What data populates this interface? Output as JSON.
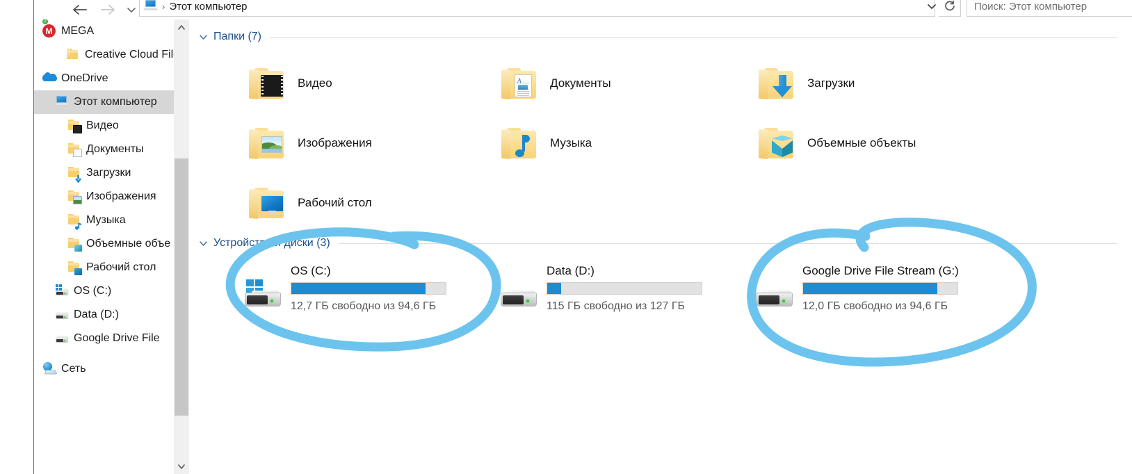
{
  "window": {
    "address": {
      "crumb_root": "Этот компьютер",
      "separator": "›",
      "dropdown_icon": "chevron-down-icon",
      "refresh_icon": "refresh-icon"
    },
    "search": {
      "placeholder": "Поиск: Этот компьютер",
      "value": ""
    },
    "nav_buttons": {
      "back": "back-arrow-icon",
      "forward": "forward-arrow-icon",
      "recent": "recent-locations-chevron-icon",
      "up": "up-arrow-icon"
    }
  },
  "sidebar": {
    "items": [
      {
        "label": "MEGA",
        "icon": "mega-icon",
        "indent": 0,
        "selected": false
      },
      {
        "label": "Creative Cloud File",
        "icon": "folder-icon",
        "indent": 1,
        "selected": false
      },
      {
        "label": "OneDrive",
        "icon": "onedrive-cloud-icon",
        "indent": 0,
        "selected": false
      },
      {
        "label": "Этот компьютер",
        "icon": "this-pc-icon",
        "indent": 1,
        "selected": true
      },
      {
        "label": "Видео",
        "icon": "videos-folder-icon",
        "indent": 2,
        "selected": false
      },
      {
        "label": "Документы",
        "icon": "documents-folder-icon",
        "indent": 2,
        "selected": false
      },
      {
        "label": "Загрузки",
        "icon": "downloads-folder-icon",
        "indent": 2,
        "selected": false
      },
      {
        "label": "Изображения",
        "icon": "pictures-folder-icon",
        "indent": 2,
        "selected": false
      },
      {
        "label": "Музыка",
        "icon": "music-folder-icon",
        "indent": 2,
        "selected": false
      },
      {
        "label": "Объемные объе",
        "icon": "3d-objects-folder-icon",
        "indent": 2,
        "selected": false
      },
      {
        "label": "Рабочий стол",
        "icon": "desktop-folder-icon",
        "indent": 2,
        "selected": false
      },
      {
        "label": "OS (C:)",
        "icon": "windows-drive-icon",
        "indent": 1,
        "selected": false
      },
      {
        "label": "Data (D:)",
        "icon": "drive-icon",
        "indent": 1,
        "selected": false
      },
      {
        "label": "Google Drive File",
        "icon": "drive-icon",
        "indent": 1,
        "selected": false
      },
      {
        "label": "Сеть",
        "icon": "network-icon",
        "indent": 0,
        "selected": false
      }
    ],
    "scrollbar": {
      "up_arrow": "chevron-up-icon",
      "down_arrow": "chevron-down-icon"
    }
  },
  "content": {
    "groups": [
      {
        "title": "Папки (7)",
        "chevron": "chevron-down-icon"
      },
      {
        "title": "Устройства и диски (3)",
        "chevron": "chevron-down-icon"
      }
    ],
    "folders": [
      {
        "label": "Видео",
        "icon": "videos-folder-icon"
      },
      {
        "label": "Документы",
        "icon": "documents-folder-icon"
      },
      {
        "label": "Загрузки",
        "icon": "downloads-folder-icon"
      },
      {
        "label": "Изображения",
        "icon": "pictures-folder-icon"
      },
      {
        "label": "Музыка",
        "icon": "music-folder-icon"
      },
      {
        "label": "Объемные объекты",
        "icon": "3d-objects-folder-icon"
      },
      {
        "label": "Рабочий стол",
        "icon": "desktop-folder-icon"
      }
    ],
    "drives": [
      {
        "name": "OS (C:)",
        "free_text": "12,7 ГБ свободно из 94,6 ГБ",
        "used_percent": 87,
        "icon": "windows-drive-icon"
      },
      {
        "name": "Data (D:)",
        "free_text": "115 ГБ свободно из 127 ГБ",
        "used_percent": 9,
        "icon": "drive-icon"
      },
      {
        "name": "Google Drive File Stream (G:)",
        "free_text": "12,0 ГБ свободно из 94,6 ГБ",
        "used_percent": 87,
        "icon": "drive-icon"
      }
    ]
  },
  "annotations": {
    "color": "#6cc4ee",
    "shapes": [
      {
        "name": "highlight-circle-os-c",
        "description": "hand drawn oval around OS (C:) drive"
      },
      {
        "name": "highlight-circle-google-drive",
        "description": "hand drawn oval around Google Drive File Stream (G:) drive"
      }
    ]
  },
  "colors": {
    "accent_blue": "#1e8bd4",
    "group_header": "#1a4f8a",
    "selection_gray": "#d6d6d6",
    "annotation_blue": "#6cc4ee"
  }
}
